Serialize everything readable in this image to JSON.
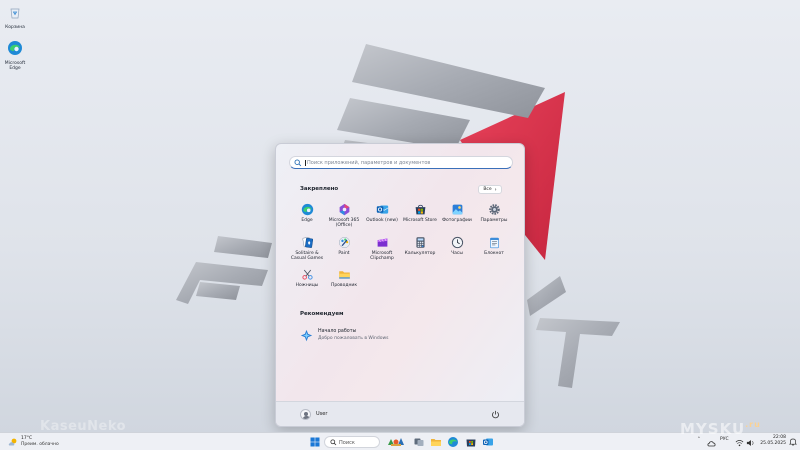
{
  "desktop": {
    "icons": [
      {
        "label": "Корзина",
        "icon": "recycle-bin-icon"
      },
      {
        "label": "Microsoft Edge",
        "icon": "edge-icon"
      }
    ]
  },
  "start_menu": {
    "search_placeholder": "Поиск приложений, параметров и документов",
    "pinned_title": "Закреплено",
    "all_button": "Все",
    "pinned": [
      {
        "label": "Edge",
        "icon": "edge-icon"
      },
      {
        "label": "Microsoft 365 (Office)",
        "icon": "microsoft-365-icon"
      },
      {
        "label": "Outlook (new)",
        "icon": "outlook-icon"
      },
      {
        "label": "Microsoft Store",
        "icon": "store-icon"
      },
      {
        "label": "Фотографии",
        "icon": "photos-icon"
      },
      {
        "label": "Параметры",
        "icon": "settings-gear-icon"
      },
      {
        "label": "Solitaire & Casual Games",
        "icon": "solitaire-icon"
      },
      {
        "label": "Paint",
        "icon": "paint-icon"
      },
      {
        "label": "Microsoft Clipchamp",
        "icon": "clipchamp-icon"
      },
      {
        "label": "Калькулятор",
        "icon": "calculator-icon"
      },
      {
        "label": "Часы",
        "icon": "clock-icon"
      },
      {
        "label": "Блокнот",
        "icon": "notepad-icon"
      },
      {
        "label": "Ножницы",
        "icon": "snipping-tool-icon"
      },
      {
        "label": "Проводник",
        "icon": "file-explorer-icon"
      }
    ],
    "recommended_title": "Рекомендуем",
    "recommended": [
      {
        "title": "Начало работы",
        "subtitle": "Добро пожаловать в Windows",
        "icon": "get-started-icon"
      }
    ],
    "user_name": "User"
  },
  "taskbar": {
    "weather_temp": "17°C",
    "weather_desc": "Преим. облачно",
    "search_label": "Поиск",
    "language": "РУС",
    "time": "22:08",
    "date": "25.05.2025"
  },
  "watermark": {
    "left": "KaseuNeko",
    "right": "MYSKU",
    "right_suffix": ".ru"
  },
  "colors": {
    "accent": "#3a6fb9",
    "wallpaper_red": "#d8304a",
    "taskbar": "#eef0f5"
  }
}
